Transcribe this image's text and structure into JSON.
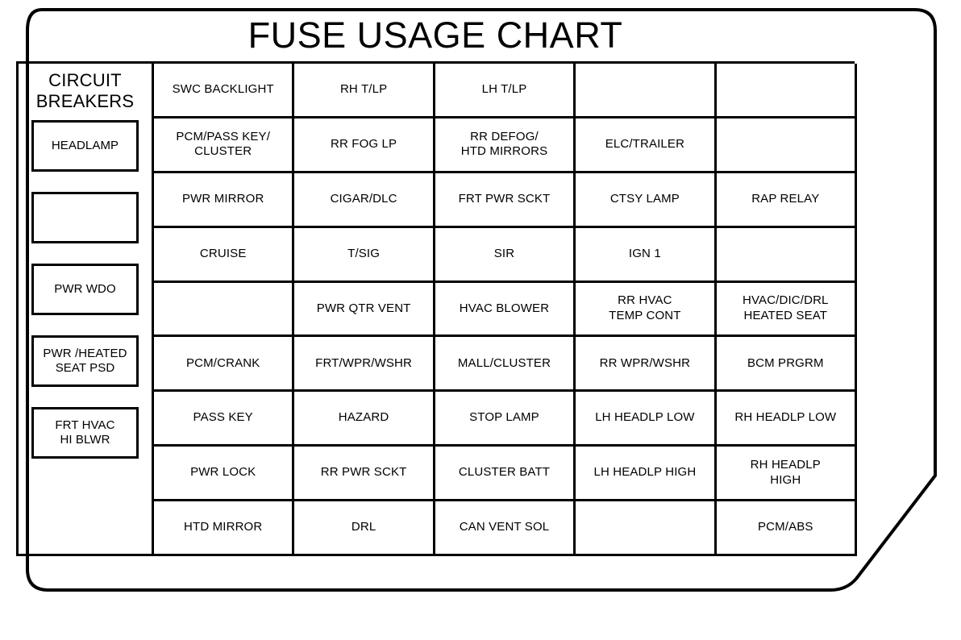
{
  "placard": {
    "title": "FUSE USAGE CHART",
    "stroke_color": "#000000",
    "background_color": "#ffffff"
  },
  "circuit_breakers": {
    "heading_line1": "CIRCUIT",
    "heading_line2": "BREAKERS",
    "boxes": [
      {
        "lines": [
          "HEADLAMP"
        ]
      },
      {
        "lines": []
      },
      {
        "lines": [
          "PWR WDO"
        ]
      },
      {
        "lines": [
          "PWR /HEATED",
          "SEAT PSD"
        ]
      },
      {
        "lines": [
          "FRT HVAC",
          "HI BLWR"
        ]
      }
    ]
  },
  "fuse_grid": {
    "columns": 5,
    "rows": 9,
    "cells": [
      [
        {
          "lines": [
            "SWC BACKLIGHT"
          ]
        },
        {
          "lines": [
            "RH T/LP"
          ]
        },
        {
          "lines": [
            "LH T/LP"
          ]
        },
        {
          "lines": []
        },
        {
          "lines": []
        }
      ],
      [
        {
          "lines": [
            "PCM/PASS KEY/",
            "CLUSTER"
          ]
        },
        {
          "lines": [
            "RR FOG LP"
          ]
        },
        {
          "lines": [
            "RR DEFOG/",
            "HTD MIRRORS"
          ]
        },
        {
          "lines": [
            "ELC/TRAILER"
          ]
        },
        {
          "lines": []
        }
      ],
      [
        {
          "lines": [
            "PWR MIRROR"
          ]
        },
        {
          "lines": [
            "CIGAR/DLC"
          ]
        },
        {
          "lines": [
            "FRT PWR SCKT"
          ]
        },
        {
          "lines": [
            "CTSY LAMP"
          ]
        },
        {
          "lines": [
            "RAP RELAY"
          ]
        }
      ],
      [
        {
          "lines": [
            "CRUISE"
          ]
        },
        {
          "lines": [
            "T/SIG"
          ]
        },
        {
          "lines": [
            "SIR"
          ]
        },
        {
          "lines": [
            "IGN 1"
          ]
        },
        {
          "lines": []
        }
      ],
      [
        {
          "lines": []
        },
        {
          "lines": [
            "PWR QTR VENT"
          ]
        },
        {
          "lines": [
            "HVAC BLOWER"
          ]
        },
        {
          "lines": [
            "RR HVAC",
            "TEMP CONT"
          ]
        },
        {
          "lines": [
            "HVAC/DIC/DRL",
            "HEATED SEAT"
          ]
        }
      ],
      [
        {
          "lines": [
            "PCM/CRANK"
          ]
        },
        {
          "lines": [
            "FRT/WPR/WSHR"
          ]
        },
        {
          "lines": [
            "MALL/CLUSTER"
          ]
        },
        {
          "lines": [
            "RR WPR/WSHR"
          ]
        },
        {
          "lines": [
            "BCM PRGRM"
          ]
        }
      ],
      [
        {
          "lines": [
            "PASS KEY"
          ]
        },
        {
          "lines": [
            "HAZARD"
          ]
        },
        {
          "lines": [
            "STOP LAMP"
          ]
        },
        {
          "lines": [
            "LH HEADLP LOW"
          ]
        },
        {
          "lines": [
            "RH HEADLP LOW"
          ]
        }
      ],
      [
        {
          "lines": [
            "PWR LOCK"
          ]
        },
        {
          "lines": [
            "RR PWR SCKT"
          ]
        },
        {
          "lines": [
            "CLUSTER BATT"
          ]
        },
        {
          "lines": [
            "LH HEADLP HIGH"
          ]
        },
        {
          "lines": [
            "RH HEADLP",
            "HIGH"
          ]
        }
      ],
      [
        {
          "lines": [
            "HTD MIRROR"
          ]
        },
        {
          "lines": [
            "DRL"
          ]
        },
        {
          "lines": [
            "CAN VENT SOL"
          ]
        },
        {
          "lines": []
        },
        {
          "lines": [
            "PCM/ABS"
          ]
        }
      ]
    ]
  }
}
